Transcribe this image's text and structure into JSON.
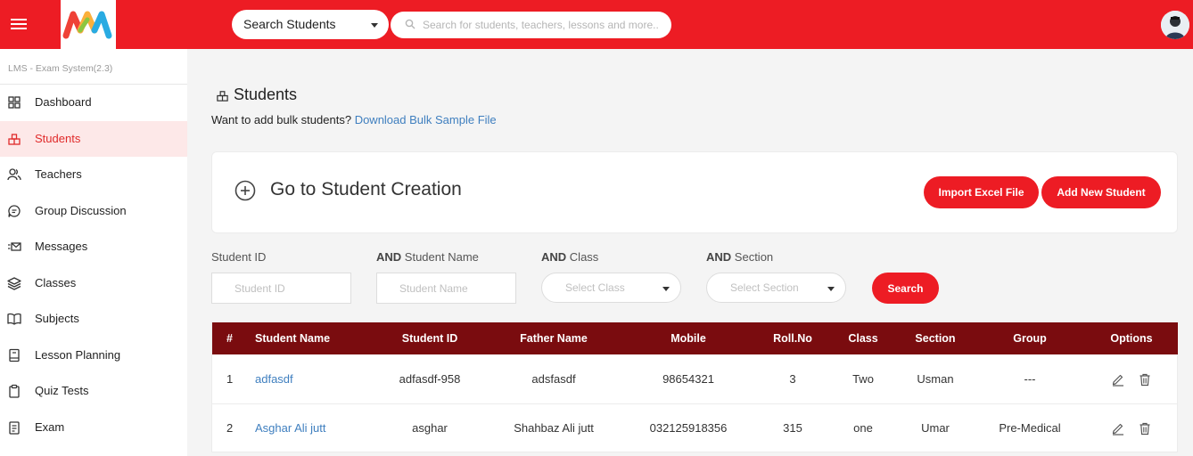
{
  "header": {
    "search_type": "Search Students",
    "search_placeholder": "Search for students, teachers, lessons and more..",
    "brand_colors": {
      "primary": "#ed1c24",
      "table_header": "#7a0c0f",
      "link": "#3f7fbf"
    }
  },
  "sidebar": {
    "system_title": "LMS - Exam System(2.3)",
    "items": [
      {
        "label": "Dashboard",
        "icon": "grid-icon"
      },
      {
        "label": "Students",
        "icon": "students-icon",
        "active": true
      },
      {
        "label": "Teachers",
        "icon": "users-icon"
      },
      {
        "label": "Group Discussion",
        "icon": "chat-icon"
      },
      {
        "label": "Messages",
        "icon": "mail-icon"
      },
      {
        "label": "Classes",
        "icon": "layers-icon"
      },
      {
        "label": "Subjects",
        "icon": "book-icon"
      },
      {
        "label": "Lesson Planning",
        "icon": "notebook-icon"
      },
      {
        "label": "Quiz Tests",
        "icon": "clipboard-icon"
      },
      {
        "label": "Exam",
        "icon": "exam-icon"
      }
    ]
  },
  "main": {
    "title": "Students",
    "bulk_text": "Want to add bulk students?",
    "bulk_link": "Download Bulk Sample File",
    "creation_title": "Go to Student Creation",
    "import_button": "Import Excel File",
    "add_button": "Add New Student",
    "filters": {
      "and_word": "AND",
      "student_id_label": "Student ID",
      "student_id_placeholder": "Student ID",
      "student_name_label": "Student Name",
      "student_name_placeholder": "Student Name",
      "class_label": "Class",
      "class_placeholder": "Select Class",
      "section_label": "Section",
      "section_placeholder": "Select Section",
      "search_button": "Search"
    },
    "table": {
      "columns": [
        "#",
        "Student Name",
        "Student ID",
        "Father Name",
        "Mobile",
        "Roll.No",
        "Class",
        "Section",
        "Group",
        "Options"
      ],
      "rows": [
        [
          "1",
          "adfasdf",
          "adfasdf-958",
          "adsfasdf",
          "98654321",
          "3",
          "Two",
          "Usman",
          "---"
        ],
        [
          "2",
          "Asghar Ali jutt",
          "asghar",
          "Shahbaz Ali jutt",
          "032125918356",
          "315",
          "one",
          "Umar",
          "Pre-Medical"
        ]
      ]
    }
  }
}
